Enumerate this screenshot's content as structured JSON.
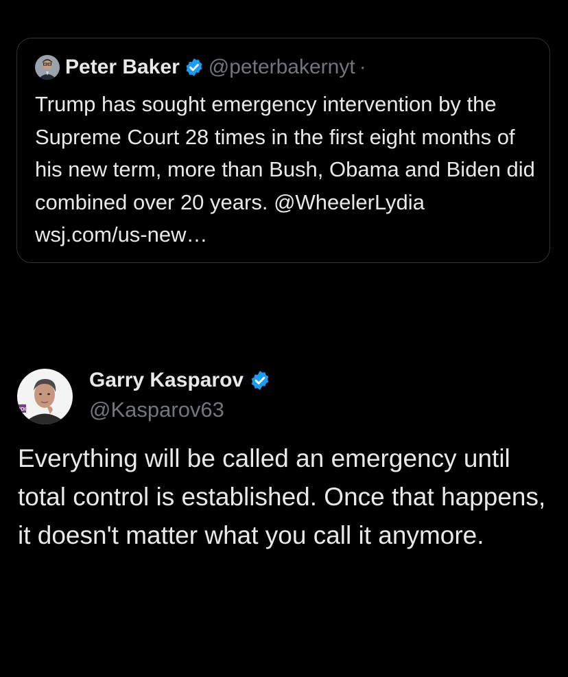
{
  "quoted_tweet": {
    "author_name": "Peter Baker",
    "handle": "@peterbakernyt",
    "separator": "·",
    "text": "Trump has sought emergency intervention by the Supreme Court 28 times in the first eight months of his new term, more than Bush, Obama and Biden did combined over 20 years. @WheelerLydia wsj.com/us-new…",
    "verified": true
  },
  "tweet": {
    "author_name": "Garry Kasparov",
    "handle": "@Kasparov63",
    "verified": true,
    "avatar_badge_text": "RDI",
    "text": "Everything will be called an emergency until total control is established. Once that happens, it doesn't matter what you call it anymore."
  },
  "colors": {
    "background": "#000000",
    "primary_text": "#e7e9ea",
    "secondary_text": "#71767b",
    "border": "#2f3336",
    "verified_badge": "#1d9bf0"
  },
  "icons": {
    "verified": "verified-badge-icon",
    "avatar": "avatar"
  }
}
